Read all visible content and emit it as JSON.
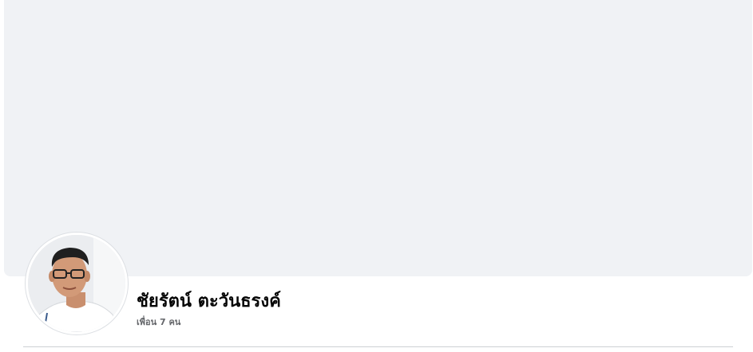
{
  "profile": {
    "name": "ชัยรัตน์ ตะวันธรงค์",
    "friends_text": "เพื่อน 7 คน"
  },
  "colors": {
    "cover_background": "#f0f2f5",
    "name_text": "#050505",
    "secondary_text": "#65676b",
    "divider": "#ced0d4"
  }
}
